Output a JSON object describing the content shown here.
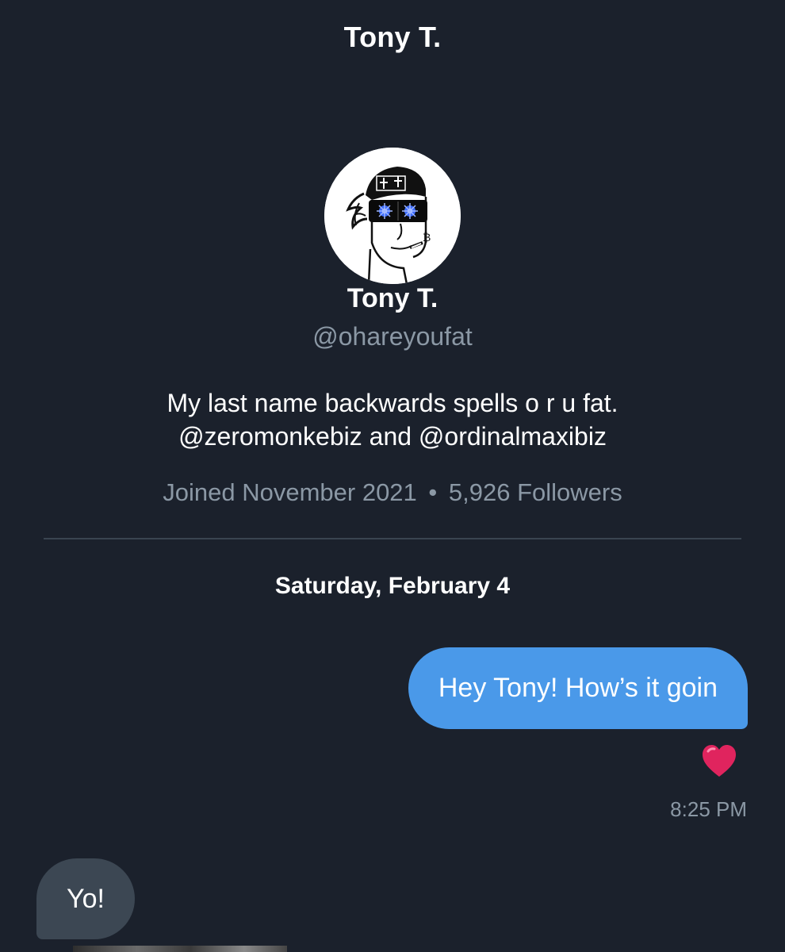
{
  "header": {
    "title": "Tony T."
  },
  "profile": {
    "avatar_icon": "nft-avatar-monkey-with-cap",
    "name": "Tony T.",
    "handle": "@ohareyoufat",
    "bio_lines": [
      "My last name backwards spells o r u fat.",
      "@zeromonkebiz and @ordinalmaxibiz"
    ],
    "joined": "Joined November 2021",
    "separator": "•",
    "followers": "5,926 Followers"
  },
  "conversation": {
    "date_label": "Saturday, February 4",
    "messages": [
      {
        "direction": "outgoing",
        "text": "Hey Tony! How’s it goin",
        "reaction_icon": "red-heart-icon",
        "timestamp": "8:25 PM"
      },
      {
        "direction": "incoming",
        "text": "Yo!"
      }
    ]
  },
  "colors": {
    "background": "#1b212c",
    "outgoing_bubble": "#4a99e9",
    "incoming_bubble": "#3c4753",
    "secondary_text": "#8b98a5",
    "heart": "#e0245e"
  }
}
